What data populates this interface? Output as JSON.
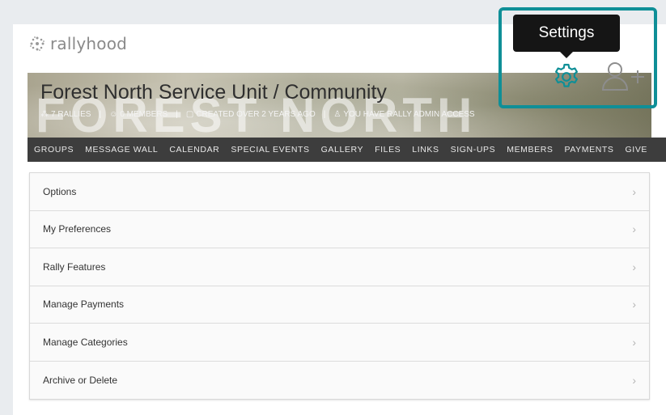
{
  "brand": {
    "name": "rallyhood"
  },
  "hero": {
    "title": "Forest North Service Unit / Community",
    "watermark": "FOREST NORTH",
    "meta": {
      "rallies": "7 RALLIES",
      "members": "0 MEMBERS",
      "created": "CREATED OVER 2 YEARS AGO",
      "access": "YOU HAVE RALLY ADMIN ACCESS"
    }
  },
  "nav": {
    "items": [
      "GROUPS",
      "MESSAGE WALL",
      "CALENDAR",
      "SPECIAL EVENTS",
      "GALLERY",
      "FILES",
      "LINKS",
      "SIGN-UPS",
      "MEMBERS",
      "PAYMENTS",
      "GIVE"
    ]
  },
  "settings_menu": {
    "items": [
      {
        "label": "Options"
      },
      {
        "label": "My Preferences"
      },
      {
        "label": "Rally Features"
      },
      {
        "label": "Manage Payments"
      },
      {
        "label": "Manage Categories"
      },
      {
        "label": "Archive or Delete"
      }
    ],
    "chevron": "›"
  },
  "tooltip": {
    "text": "Settings"
  },
  "icons": {
    "settings": "gear-icon",
    "invite": "add-user-icon",
    "logo": "rallyhood-logo-icon"
  },
  "colors": {
    "highlight": "#0f8f97",
    "nav_bg": "#3d3d3d",
    "tooltip_bg": "#151515",
    "icon": "#0f8f97"
  }
}
